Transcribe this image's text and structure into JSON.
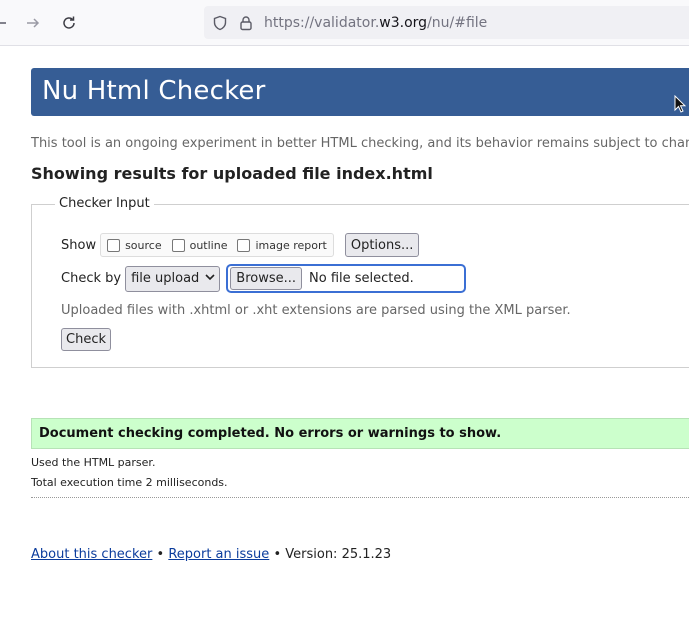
{
  "browser": {
    "url_prefix": "https://validator.",
    "url_domain": "w3.org",
    "url_suffix": "/nu/#file"
  },
  "page": {
    "title": "Nu Html Checker",
    "tagline": "This tool is an ongoing experiment in better HTML checking, and its behavior remains subject to change",
    "results_heading": "Showing results for uploaded file index.html"
  },
  "checker_input": {
    "legend": "Checker Input",
    "show_label": "Show",
    "show_options": [
      {
        "label": "source",
        "checked": false
      },
      {
        "label": "outline",
        "checked": false
      },
      {
        "label": "image report",
        "checked": false
      }
    ],
    "options_button": "Options...",
    "check_by_label": "Check by",
    "check_by_value": "file upload",
    "browse_button": "Browse...",
    "file_status": "No file selected.",
    "note": "Uploaded files with .xhtml or .xht extensions are parsed using the XML parser.",
    "check_button": "Check"
  },
  "results": {
    "success_message": "Document checking completed. No errors or warnings to show.",
    "parser_info": "Used the HTML parser.",
    "execution_time": "Total execution time 2 milliseconds."
  },
  "footer": {
    "about_link": "About this checker",
    "separator": "•",
    "report_link": "Report an issue",
    "version": "Version: 25.1.23"
  },
  "colors": {
    "header_bg": "#365d95",
    "success_bg": "#ccffcc",
    "focus_ring": "#3b6fd4"
  }
}
